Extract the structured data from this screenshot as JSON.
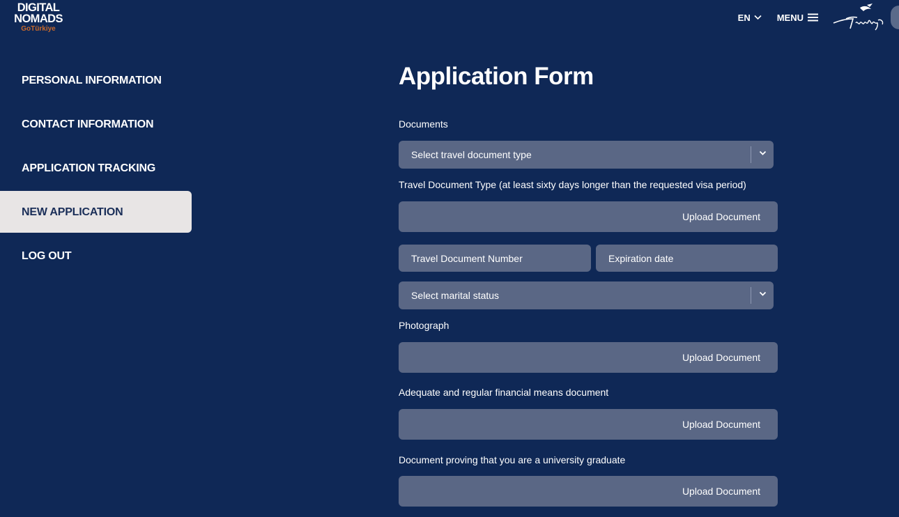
{
  "header": {
    "logo_line1": "DIGITAL",
    "logo_line2": "NOMADS",
    "logo_line3": "GoTürkiye",
    "lang": "EN",
    "menu": "MENU",
    "brand_icon": "turkiye-logo-icon"
  },
  "sidebar": {
    "items": [
      {
        "label": "PERSONAL INFORMATION"
      },
      {
        "label": "CONTACT INFORMATION"
      },
      {
        "label": "APPLICATION TRACKING"
      },
      {
        "label": "NEW APPLICATION",
        "active": true
      },
      {
        "label": "LOG OUT"
      }
    ]
  },
  "form": {
    "title": "Application Form",
    "documents_label": "Documents",
    "doc_type_placeholder": "Select travel document type",
    "travel_doc_label": "Travel Document Type (at least sixty days longer than the requested visa period)",
    "upload_label": "Upload Document",
    "doc_number_placeholder": "Travel Document Number",
    "expiration_placeholder": "Expiration date",
    "marital_placeholder": "Select marital status",
    "photograph_label": "Photograph",
    "financial_label": "Adequate and regular financial means document",
    "graduate_label": "Document proving that you are a university graduate"
  },
  "colors": {
    "background": "#0f2856",
    "field": "#5a6785",
    "active_item": "#e8e5e5",
    "logo_accent": "#c8692b"
  }
}
